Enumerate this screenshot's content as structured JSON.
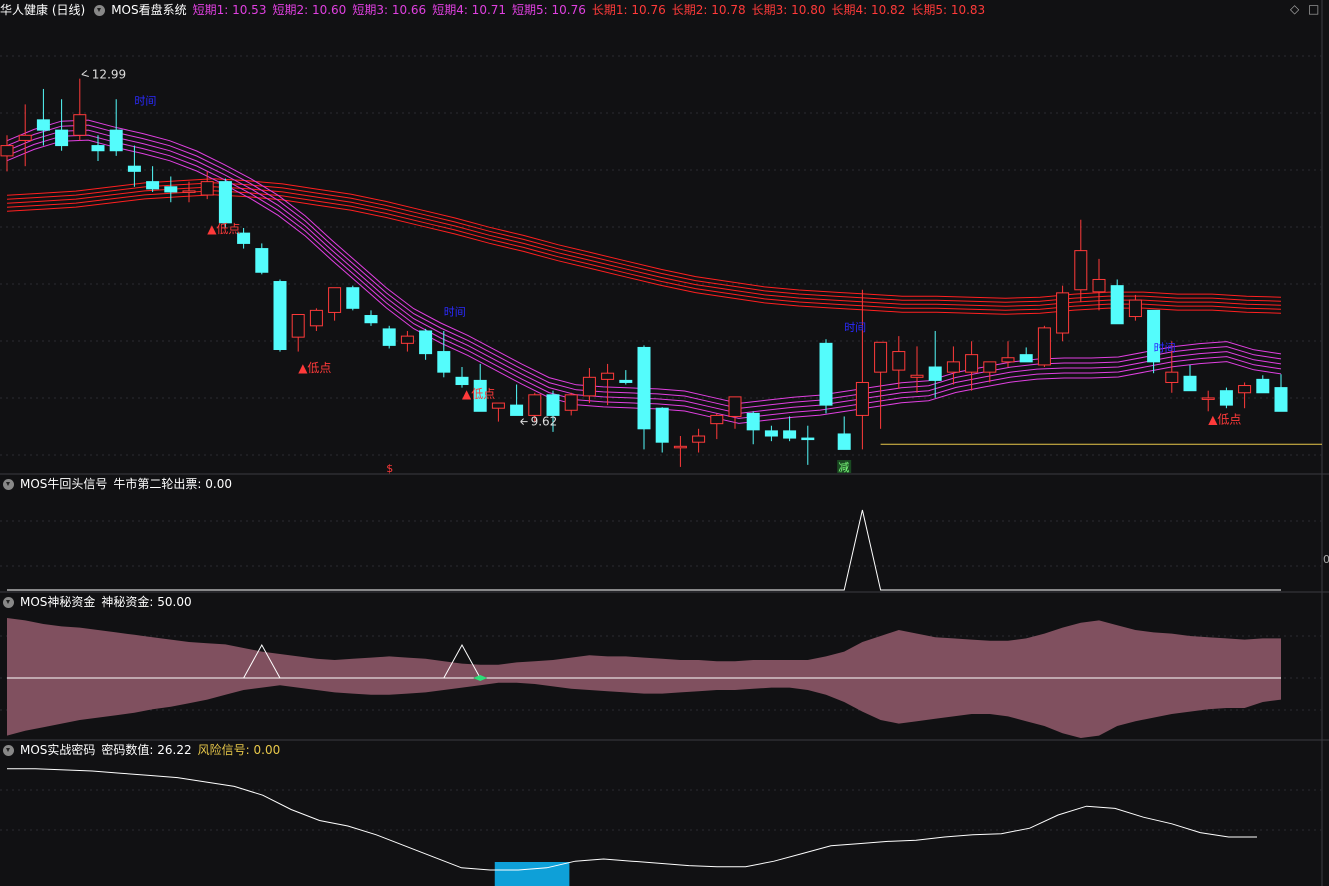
{
  "main_header": {
    "stock": "华人健康 (日线)",
    "system": "MOS看盘系统",
    "items": [
      {
        "label": "短期1: 10.53",
        "color": "#e040e0"
      },
      {
        "label": "短期2: 10.60",
        "color": "#e040e0"
      },
      {
        "label": "短期3: 10.66",
        "color": "#e040e0"
      },
      {
        "label": "短期4: 10.71",
        "color": "#e040e0"
      },
      {
        "label": "短期5: 10.76",
        "color": "#e040e0"
      },
      {
        "label": "长期1: 10.76",
        "color": "#ff3a3a"
      },
      {
        "label": "长期2: 10.78",
        "color": "#ff3a3a"
      },
      {
        "label": "长期3: 10.80",
        "color": "#ff3a3a"
      },
      {
        "label": "长期4: 10.82",
        "color": "#ff3a3a"
      },
      {
        "label": "长期5: 10.83",
        "color": "#ff3a3a"
      }
    ]
  },
  "panel2_header": {
    "name": "MOS牛回头信号",
    "value": "牛市第二轮出票: 0.00"
  },
  "panel3_header": {
    "name": "MOS神秘资金",
    "value": "神秘资金: 50.00"
  },
  "panel4_header": {
    "name": "MOS实战密码",
    "value": "密码数值: 26.22",
    "risk": "风险信号: 0.00"
  },
  "annotations": {
    "high": "12.99",
    "low": "9.62",
    "low_point": "▲低点",
    "time_label": "时间",
    "s_marker": "$",
    "jian_marker": "减",
    "right_tick": "0"
  },
  "corner_icons": [
    "diamond-icon",
    "square-icon"
  ],
  "colors": {
    "up": "#ff3a3a",
    "down": "#54fcfc",
    "short_ma": "#e040e0",
    "long_ma": "#ff2020",
    "support": "#e8c84a",
    "fund": "#80505f",
    "line": "#ffffff"
  },
  "chart_data": [
    {
      "type": "candlestick",
      "name": "华人健康 (日线)",
      "ylim": [
        9.15,
        13.5
      ],
      "bars_ohlc": [
        [
          12.2,
          12.4,
          12.05,
          12.3
        ],
        [
          12.35,
          12.7,
          12.1,
          12.4
        ],
        [
          12.55,
          12.85,
          12.3,
          12.45
        ],
        [
          12.45,
          12.75,
          12.25,
          12.3
        ],
        [
          12.4,
          12.95,
          12.35,
          12.6
        ],
        [
          12.3,
          12.4,
          12.15,
          12.25
        ],
        [
          12.45,
          12.75,
          12.2,
          12.25
        ],
        [
          12.1,
          12.3,
          11.9,
          12.05
        ],
        [
          11.95,
          12.1,
          11.85,
          11.88
        ],
        [
          11.9,
          12.0,
          11.75,
          11.85
        ],
        [
          11.85,
          11.95,
          11.75,
          11.86
        ],
        [
          11.82,
          12.05,
          11.78,
          11.95
        ],
        [
          11.95,
          11.98,
          11.5,
          11.55
        ],
        [
          11.45,
          11.5,
          11.3,
          11.35
        ],
        [
          11.3,
          11.35,
          11.05,
          11.07
        ],
        [
          10.98,
          11.0,
          10.3,
          10.32
        ],
        [
          10.44,
          10.65,
          10.3,
          10.66
        ],
        [
          10.55,
          10.72,
          10.5,
          10.7
        ],
        [
          10.68,
          10.88,
          10.6,
          10.92
        ],
        [
          10.92,
          10.94,
          10.7,
          10.72
        ],
        [
          10.65,
          10.7,
          10.55,
          10.58
        ],
        [
          10.52,
          10.55,
          10.33,
          10.36
        ],
        [
          10.38,
          10.5,
          10.3,
          10.45
        ],
        [
          10.5,
          10.52,
          10.22,
          10.28
        ],
        [
          10.3,
          10.5,
          10.05,
          10.1
        ],
        [
          10.05,
          10.15,
          9.95,
          9.98
        ],
        [
          10.02,
          10.18,
          9.74,
          9.72
        ],
        [
          9.75,
          9.8,
          9.62,
          9.8
        ],
        [
          9.78,
          9.98,
          9.7,
          9.68
        ],
        [
          9.68,
          9.9,
          9.62,
          9.88
        ],
        [
          9.88,
          9.92,
          9.52,
          9.68
        ],
        [
          9.73,
          9.9,
          9.68,
          9.88
        ],
        [
          9.87,
          10.14,
          9.8,
          10.05
        ],
        [
          10.03,
          10.18,
          9.78,
          10.09
        ],
        [
          10.02,
          10.12,
          9.98,
          10.0
        ],
        [
          10.34,
          10.36,
          9.35,
          9.55
        ],
        [
          9.75,
          9.76,
          9.32,
          9.42
        ],
        [
          9.38,
          9.48,
          9.18,
          9.38
        ],
        [
          9.42,
          9.55,
          9.32,
          9.48
        ],
        [
          9.6,
          9.7,
          9.45,
          9.68
        ],
        [
          9.67,
          9.84,
          9.55,
          9.86
        ],
        [
          9.7,
          9.72,
          9.4,
          9.54
        ],
        [
          9.53,
          9.58,
          9.43,
          9.48
        ],
        [
          9.53,
          9.67,
          9.43,
          9.46
        ],
        [
          9.46,
          9.58,
          9.2,
          9.45
        ],
        [
          10.38,
          10.42,
          9.7,
          9.78
        ],
        [
          9.5,
          9.67,
          9.35,
          9.35
        ],
        [
          9.68,
          10.9,
          9.35,
          10.0
        ],
        [
          10.1,
          10.3,
          9.55,
          10.39
        ],
        [
          10.12,
          10.45,
          9.94,
          10.3
        ],
        [
          10.05,
          10.35,
          9.9,
          10.07
        ],
        [
          10.15,
          10.5,
          9.85,
          10.02
        ],
        [
          10.1,
          10.35,
          9.98,
          10.2
        ],
        [
          10.1,
          10.4,
          9.92,
          10.27
        ],
        [
          10.1,
          10.15,
          10.0,
          10.2
        ],
        [
          10.2,
          10.4,
          10.15,
          10.24
        ],
        [
          10.27,
          10.34,
          10.2,
          10.2
        ],
        [
          10.17,
          10.55,
          10.15,
          10.53
        ],
        [
          10.48,
          10.94,
          10.4,
          10.87
        ],
        [
          10.9,
          11.58,
          10.78,
          11.28
        ],
        [
          10.88,
          11.2,
          10.7,
          11.0
        ],
        [
          10.94,
          11.0,
          10.57,
          10.57
        ],
        [
          10.64,
          10.85,
          10.6,
          10.8
        ],
        [
          10.7,
          10.68,
          10.09,
          10.2
        ],
        [
          10.0,
          10.4,
          9.9,
          10.1
        ],
        [
          10.06,
          10.17,
          9.95,
          9.92
        ],
        [
          9.85,
          9.92,
          9.72,
          9.85
        ],
        [
          9.92,
          9.95,
          9.75,
          9.78
        ],
        [
          9.9,
          10.0,
          9.75,
          9.97
        ],
        [
          10.03,
          10.07,
          9.9,
          9.9
        ],
        [
          9.95,
          10.08,
          9.8,
          9.72
        ]
      ],
      "short_ma": [
        12.25,
        12.36,
        12.44,
        12.45,
        12.38,
        12.32,
        12.25,
        12.15,
        12.02,
        11.88,
        11.72,
        11.52,
        11.28,
        11.05,
        10.82,
        10.62,
        10.48,
        10.36,
        10.22,
        10.08,
        9.95,
        9.88,
        9.86,
        9.85,
        9.84,
        9.82,
        9.76,
        9.7,
        9.73,
        9.76,
        9.78,
        9.82,
        9.86,
        9.9,
        9.92,
        10.0,
        10.05,
        10.1,
        10.13,
        10.14,
        10.14,
        10.15,
        10.2,
        10.25,
        10.28,
        10.3,
        10.22,
        10.18
      ],
      "long_ma": [
        11.74,
        11.76,
        11.78,
        11.82,
        11.86,
        11.88,
        11.9,
        11.88,
        11.85,
        11.8,
        11.75,
        11.68,
        11.6,
        11.52,
        11.43,
        11.35,
        11.26,
        11.18,
        11.1,
        11.02,
        10.95,
        10.9,
        10.85,
        10.82,
        10.8,
        10.78,
        10.76,
        10.76,
        10.75,
        10.74,
        10.75,
        10.78,
        10.8,
        10.8,
        10.78,
        10.78,
        10.76,
        10.75
      ],
      "support_level": 9.4,
      "high_label": 12.99,
      "low_label": 9.62
    },
    {
      "type": "line",
      "name": "MOS牛回头信号",
      "values": [
        0,
        0,
        0,
        0,
        0,
        0,
        0,
        0,
        0,
        0,
        0,
        0,
        0,
        0,
        0,
        0,
        0,
        0,
        0,
        0,
        0,
        0,
        0,
        0,
        0,
        0,
        0,
        0,
        0,
        0,
        0,
        0,
        0,
        0,
        0,
        0,
        0,
        0,
        0,
        0,
        0,
        0,
        0,
        0,
        0,
        0,
        0,
        1,
        0,
        0,
        0,
        0,
        0,
        0,
        0,
        0,
        0,
        0,
        0,
        0,
        0,
        0,
        0,
        0,
        0,
        0,
        0,
        0,
        0,
        0,
        0
      ],
      "ylim": [
        0,
        1.2
      ]
    },
    {
      "type": "area",
      "name": "MOS神秘资金",
      "upper": [
        50,
        48,
        45,
        43,
        42,
        40,
        38,
        36,
        34,
        32,
        30,
        29,
        28,
        25,
        22,
        20,
        18,
        16,
        15,
        16,
        17,
        18,
        17,
        16,
        14,
        12,
        11,
        11,
        13,
        14,
        15,
        17,
        19,
        18,
        18,
        17,
        16,
        15,
        15,
        14,
        14,
        15,
        15,
        15,
        15,
        18,
        22,
        30,
        35,
        40,
        37,
        34,
        33,
        32,
        31,
        31,
        33,
        37,
        42,
        46,
        48,
        44,
        40,
        38,
        37,
        35,
        34,
        33,
        32,
        33,
        33
      ],
      "lower": [
        -48,
        -44,
        -41,
        -38,
        -35,
        -33,
        -31,
        -29,
        -26,
        -24,
        -21,
        -18,
        -14,
        -10,
        -8,
        -6,
        -8,
        -10,
        -12,
        -13,
        -14,
        -14,
        -13,
        -12,
        -10,
        -8,
        -6,
        -4,
        -4,
        -5,
        -7,
        -9,
        -10,
        -11,
        -12,
        -13,
        -13,
        -12,
        -11,
        -10,
        -10,
        -9,
        -8,
        -8,
        -10,
        -14,
        -20,
        -28,
        -35,
        -38,
        -36,
        -34,
        -32,
        -30,
        -30,
        -32,
        -36,
        -40,
        -46,
        -50,
        -48,
        -40,
        -36,
        -33,
        -30,
        -28,
        -26,
        -25,
        -25,
        -20,
        -18
      ],
      "signal": [
        0,
        0,
        0,
        0,
        0,
        0,
        0,
        0,
        0,
        0,
        0,
        0,
        0,
        0,
        1,
        0,
        0,
        0,
        0,
        0,
        0,
        0,
        0,
        0,
        0,
        1,
        0,
        0,
        0,
        0,
        0,
        0,
        0,
        0,
        0,
        0,
        0,
        0,
        0,
        0,
        0,
        0,
        0,
        0,
        0,
        0,
        0,
        0,
        0,
        0,
        0,
        0,
        0,
        0,
        0,
        0,
        0,
        0,
        0,
        0,
        0,
        0,
        0,
        0,
        0,
        0,
        0,
        0,
        0,
        0,
        0
      ],
      "ylim": [
        -55,
        55
      ]
    },
    {
      "type": "line",
      "name": "MOS实战密码",
      "values": [
        92,
        92,
        91,
        90,
        88,
        86,
        84,
        80,
        76,
        68,
        55,
        45,
        40,
        32,
        22,
        12,
        2,
        0,
        0,
        2,
        8,
        10,
        8,
        6,
        4,
        3,
        3,
        8,
        15,
        22,
        24,
        26,
        27,
        30,
        32,
        33,
        38,
        50,
        58,
        56,
        48,
        42,
        34,
        30,
        30
      ],
      "ylim": [
        0,
        100
      ],
      "highlight_range": [
        26.8,
        30.9
      ]
    }
  ]
}
